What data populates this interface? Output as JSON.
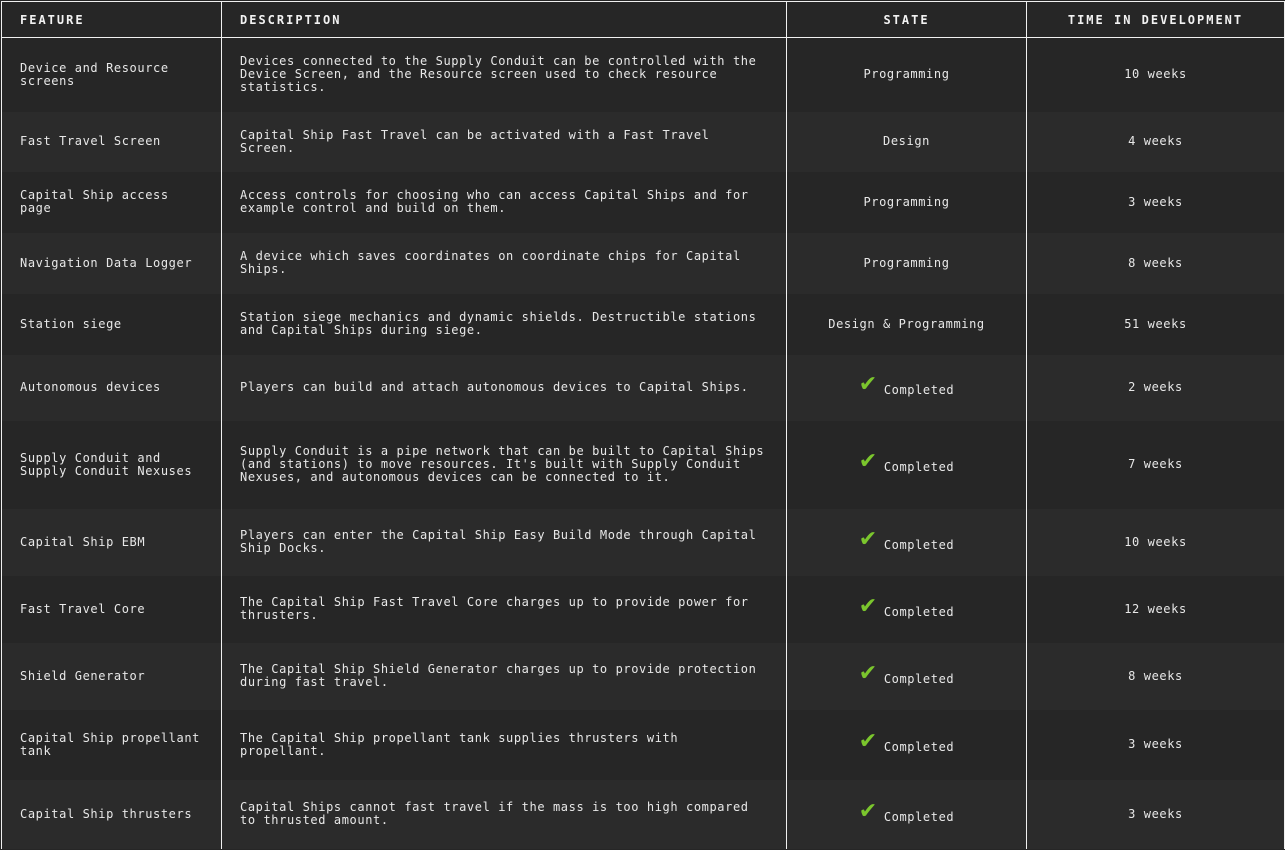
{
  "table": {
    "headers": {
      "feature": "Feature",
      "description": "Description",
      "state": "State",
      "time": "Time in Development"
    },
    "completed_icon": "checkmark-icon",
    "colors": {
      "completed_check": "#7bc62d",
      "border": "#f0f0f0",
      "row_dark": "#262626",
      "row_light": "#2b2b2b"
    },
    "rows": [
      {
        "feature": "Device and Resource screens",
        "description": "Devices connected to the Supply Conduit can be controlled with the Device Screen, and the Resource screen used to check resource statistics.",
        "state": "Programming",
        "completed": false,
        "time": "10 weeks"
      },
      {
        "feature": "Fast Travel Screen",
        "description": "Capital Ship Fast Travel can be activated with a Fast Travel Screen.",
        "state": "Design",
        "completed": false,
        "time": "4 weeks"
      },
      {
        "feature": "Capital Ship access page",
        "description": "Access controls for choosing who can access Capital Ships and for example control and build on them.",
        "state": "Programming",
        "completed": false,
        "time": "3 weeks"
      },
      {
        "feature": "Navigation Data Logger",
        "description": "A device which saves coordinates on coordinate chips for Capital Ships.",
        "state": "Programming",
        "completed": false,
        "time": "8 weeks"
      },
      {
        "feature": "Station siege",
        "description": "Station siege mechanics and dynamic shields. Destructible stations and Capital Ships during siege.",
        "state": "Design & Programming",
        "completed": false,
        "time": "51 weeks"
      },
      {
        "feature": "Autonomous devices",
        "description": "Players can build and attach autonomous devices to Capital Ships.",
        "state": "Completed",
        "completed": true,
        "time": "2 weeks"
      },
      {
        "feature": "Supply Conduit and Supply Conduit Nexuses",
        "description": "Supply Conduit is a pipe network that can be built to Capital Ships (and stations) to move resources. It's built with Supply Conduit Nexuses, and autonomous devices can be connected to it.",
        "state": "Completed",
        "completed": true,
        "time": "7 weeks"
      },
      {
        "feature": "Capital Ship EBM",
        "description": "Players can enter the Capital Ship Easy Build Mode through Capital Ship Docks.",
        "state": "Completed",
        "completed": true,
        "time": "10 weeks"
      },
      {
        "feature": "Fast Travel Core",
        "description": "The Capital Ship Fast Travel Core charges up to provide power for thrusters.",
        "state": "Completed",
        "completed": true,
        "time": "12 weeks"
      },
      {
        "feature": "Shield Generator",
        "description": "The Capital Ship Shield Generator charges up to provide protection during fast travel.",
        "state": "Completed",
        "completed": true,
        "time": "8 weeks"
      },
      {
        "feature": "Capital Ship propellant tank",
        "description": "The Capital Ship propellant tank supplies thrusters with propellant.",
        "state": "Completed",
        "completed": true,
        "time": "3 weeks"
      },
      {
        "feature": "Capital Ship thrusters",
        "description": "Capital Ships cannot fast travel if the mass is too high compared to thrusted amount.",
        "state": "Completed",
        "completed": true,
        "time": "3 weeks"
      }
    ]
  }
}
